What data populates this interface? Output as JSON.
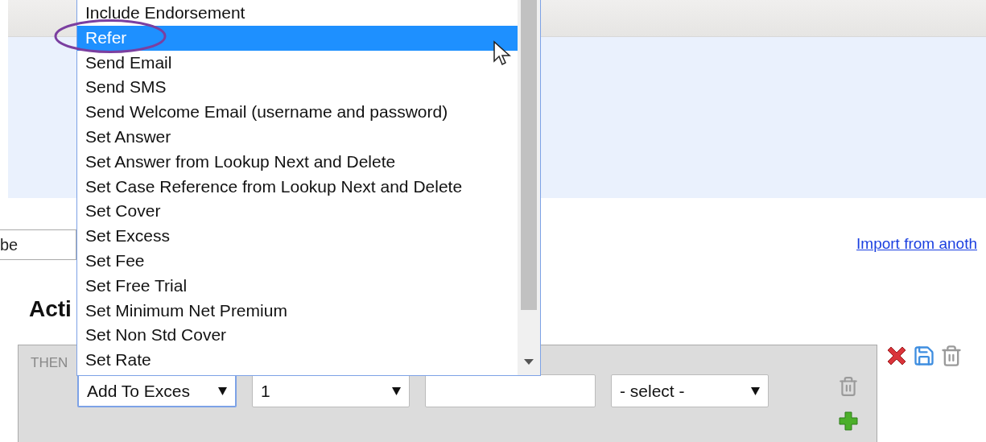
{
  "top_select": {
    "value": "be"
  },
  "import_link": "Import from anoth",
  "heading": "Acti",
  "panel": {
    "label": "THEN",
    "fields": [
      {
        "kind": "select",
        "value": "Add To Exces",
        "focused": true
      },
      {
        "kind": "select",
        "value": "1",
        "focused": false
      },
      {
        "kind": "input"
      },
      {
        "kind": "select",
        "value": "- select -",
        "focused": false
      }
    ]
  },
  "dropdown": {
    "items": [
      {
        "label": "Include Endorsement",
        "selected": false
      },
      {
        "label": "Refer",
        "selected": true
      },
      {
        "label": "Send Email",
        "selected": false
      },
      {
        "label": "Send SMS",
        "selected": false
      },
      {
        "label": "Send Welcome Email (username and password)",
        "selected": false
      },
      {
        "label": "Set Answer",
        "selected": false
      },
      {
        "label": "Set Answer from Lookup Next and Delete",
        "selected": false
      },
      {
        "label": "Set Case Reference from Lookup Next and Delete",
        "selected": false
      },
      {
        "label": "Set Cover",
        "selected": false
      },
      {
        "label": "Set Excess",
        "selected": false
      },
      {
        "label": "Set Fee",
        "selected": false
      },
      {
        "label": "Set Free Trial",
        "selected": false
      },
      {
        "label": "Set Minimum Net Premium",
        "selected": false
      },
      {
        "label": "Set Non Std Cover",
        "selected": false
      },
      {
        "label": "Set Rate",
        "selected": false
      }
    ]
  }
}
